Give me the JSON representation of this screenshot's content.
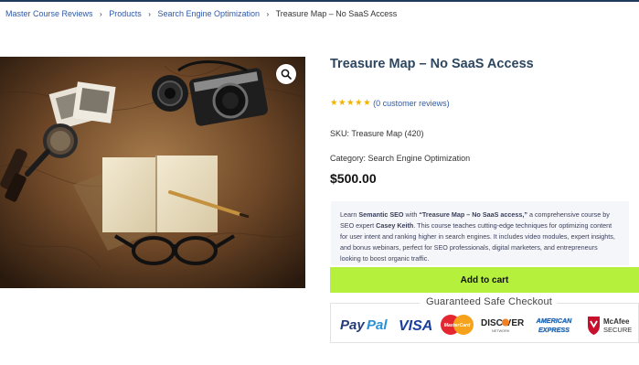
{
  "breadcrumb": {
    "items": [
      "Master Course Reviews",
      "Products",
      "Search Engine Optimization"
    ],
    "separator": "›",
    "current": "Treasure Map – No SaaS Access"
  },
  "product": {
    "title": "Treasure Map – No SaaS Access",
    "rating": {
      "stars": "★★★★★",
      "value": 5,
      "reviews_text": "(0 customer reviews)"
    },
    "sku_label": "SKU:",
    "sku_value": "Treasure Map (420)",
    "category_label": "Category:",
    "category_value": "Search Engine Optimization",
    "price": "$500.00",
    "image_alt_icons": [
      "photo-camera",
      "magnifying-glass",
      "notebook",
      "eyeglasses",
      "map"
    ],
    "description": {
      "p1": "Learn ",
      "b1": "Semantic SEO",
      "p2": " with ",
      "b2": "“Treasure Map – No SaaS access,”",
      "p3": " a comprehensive course by SEO expert ",
      "b3": "Casey Keith",
      "p4": ". This course teaches cutting-edge techniques for optimizing content for user intent and ranking higher in search engines. It includes video modules, expert insights, and bonus webinars, perfect for SEO professionals, digital marketers, and entrepreneurs looking to boost organic traffic."
    }
  },
  "actions": {
    "add_to_cart": "Add to cart"
  },
  "checkout": {
    "label": "Guaranteed Safe Checkout",
    "logos": {
      "paypal_a": "Pay",
      "paypal_b": "Pal",
      "visa": "VISA",
      "mastercard": "MasterCard",
      "discover": "DISC   VER",
      "discover_sub": "NETWORK",
      "amex_a": "AMERICAN",
      "amex_b": "EXPRESS",
      "mcafee_a": "McAfee",
      "mcafee_b": "SECURE"
    }
  },
  "colors": {
    "link": "#2e5aa8",
    "title": "#2d4660",
    "star": "#f0b400",
    "cart_button": "#b5f03c",
    "description_bg": "#f5f6fa"
  }
}
